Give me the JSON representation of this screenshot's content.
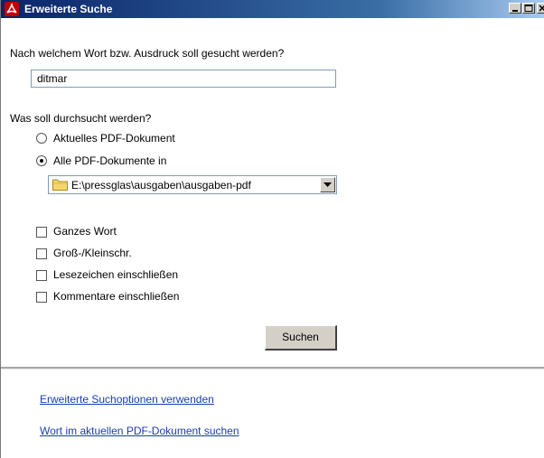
{
  "window": {
    "title": "Erweiterte Suche"
  },
  "search": {
    "prompt": "Nach welchem Wort bzw. Ausdruck soll gesucht werden?",
    "value": "ditmar"
  },
  "scope": {
    "prompt": "Was soll durchsucht werden?",
    "options": [
      {
        "label": "Aktuelles PDF-Dokument",
        "checked": false
      },
      {
        "label": "Alle PDF-Dokumente in",
        "checked": true
      }
    ],
    "folder": "E:\\pressglas\\ausgaben\\ausgaben-pdf"
  },
  "options": {
    "whole_word": "Ganzes Wort",
    "case_sensitive": "Groß-/Kleinschr.",
    "include_bookmarks": "Lesezeichen einschließen",
    "include_comments": "Kommentare einschließen"
  },
  "actions": {
    "search_label": "Suchen"
  },
  "links": {
    "advanced_options": "Erweiterte Suchoptionen verwenden",
    "find_in_current": "Wort im aktuellen PDF-Dokument suchen"
  },
  "colors": {
    "link": "#1a3cb4",
    "titlebar": "#0a246a",
    "app_icon": "#c00000"
  },
  "icons": {
    "app": "acrobat-icon",
    "folder": "folder-icon",
    "minimize": "minimize-icon",
    "maximize": "maximize-icon",
    "close": "close-icon",
    "dropdown": "chevron-down-icon"
  }
}
